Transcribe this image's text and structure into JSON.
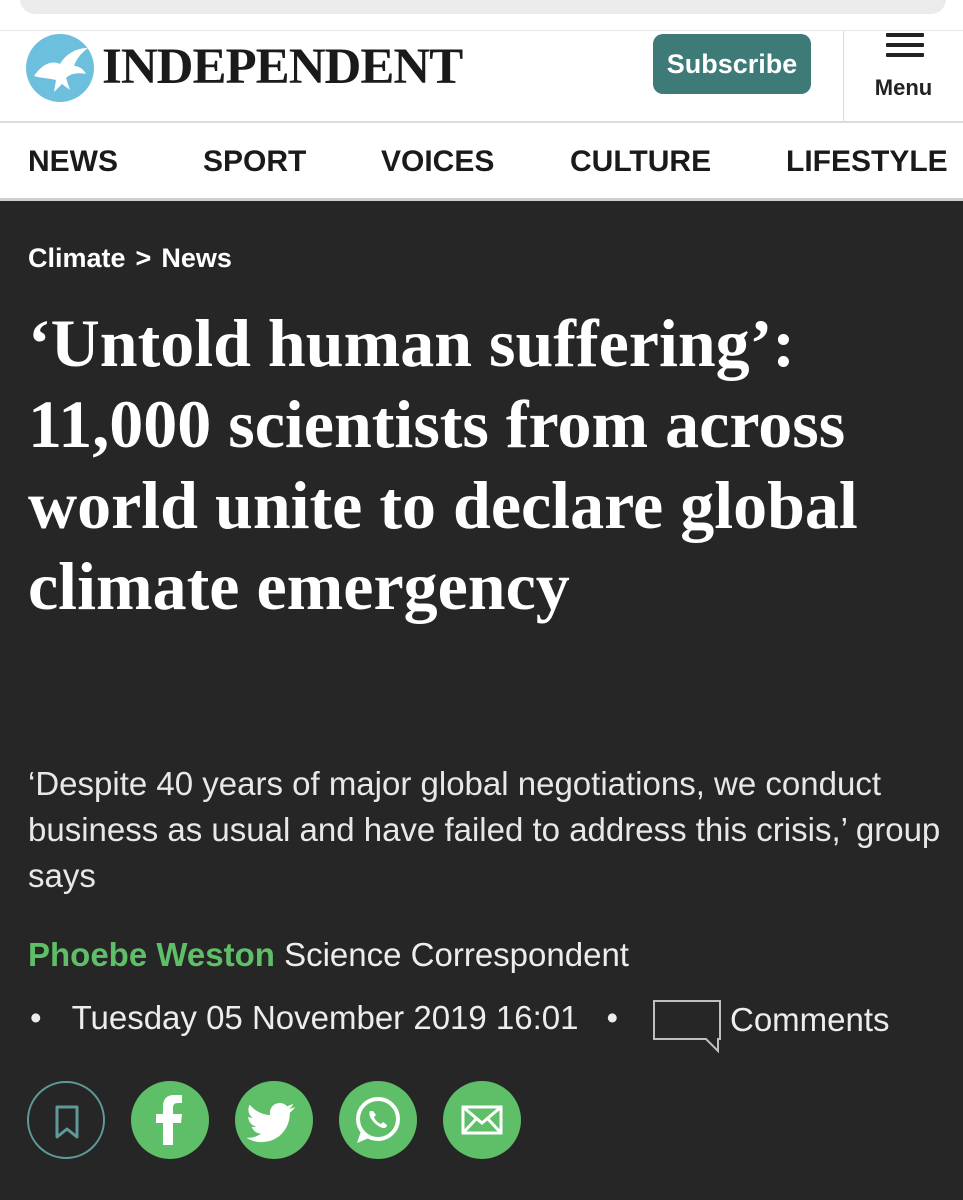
{
  "masthead": {
    "brand": "INDEPENDENT",
    "logo_icon": "eagle-logo-icon",
    "subscribe_label": "Subscribe",
    "menu_label": "Menu",
    "accent_color": "#3e7a78"
  },
  "nav": {
    "items": [
      "NEWS",
      "SPORT",
      "VOICES",
      "CULTURE",
      "LIFESTYLE"
    ]
  },
  "breadcrumb": {
    "section": "Climate",
    "separator": ">",
    "subsection": "News"
  },
  "article": {
    "headline": "‘Untold human suffering’: 11,000 scientists from across world unite to declare global climate emergency",
    "standfirst": "‘Despite 40 years of major global negotiations, we conduct business as usual and have failed to address this crisis,’ group says",
    "author": "Phoebe Weston",
    "author_role": "Science Correspondent",
    "author_color": "#5fbf68",
    "date": "Tuesday 05 November 2019 16:01",
    "comments_label": "Comments"
  },
  "share": {
    "icons": [
      "bookmark-icon",
      "facebook-icon",
      "twitter-icon",
      "whatsapp-icon",
      "email-icon"
    ]
  }
}
